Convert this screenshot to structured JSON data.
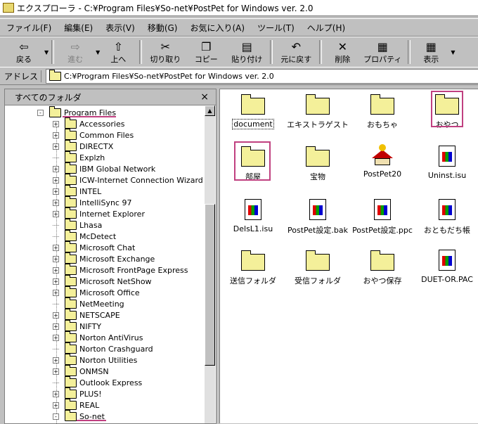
{
  "window": {
    "title": "エクスプローラ - C:¥Program Files¥So-net¥PostPet for Windows ver. 2.0"
  },
  "menu": [
    "ファイル(F)",
    "編集(E)",
    "表示(V)",
    "移動(G)",
    "お気に入り(A)",
    "ツール(T)",
    "ヘルプ(H)"
  ],
  "toolbar": {
    "back": "戻る",
    "forward": "進む",
    "up": "上へ",
    "cut": "切り取り",
    "copy": "コピー",
    "paste": "貼り付け",
    "undo": "元に戻す",
    "delete": "削除",
    "properties": "プロパティ",
    "view": "表示"
  },
  "address": {
    "label": "アドレス",
    "value": "C:¥Program Files¥So-net¥PostPet for Windows ver. 2.0"
  },
  "folders_pane": {
    "title": "すべてのフォルダ",
    "close": "×"
  },
  "tree": [
    {
      "label": "Program Files",
      "expand": "-"
    },
    {
      "label": "Accessories",
      "expand": "+"
    },
    {
      "label": "Common Files",
      "expand": "+"
    },
    {
      "label": "DIRECTX",
      "expand": "+"
    },
    {
      "label": "Explzh",
      "expand": ""
    },
    {
      "label": "IBM Global Network",
      "expand": "+"
    },
    {
      "label": "ICW-Internet Connection Wizard",
      "expand": "+"
    },
    {
      "label": "INTEL",
      "expand": "+"
    },
    {
      "label": "IntelliSync 97",
      "expand": "+"
    },
    {
      "label": "Internet Explorer",
      "expand": "+"
    },
    {
      "label": "Lhasa",
      "expand": ""
    },
    {
      "label": "McDetect",
      "expand": ""
    },
    {
      "label": "Microsoft Chat",
      "expand": "+"
    },
    {
      "label": "Microsoft Exchange",
      "expand": "+"
    },
    {
      "label": "Microsoft FrontPage Express",
      "expand": "+"
    },
    {
      "label": "Microsoft NetShow",
      "expand": "+"
    },
    {
      "label": "Microsoft Office",
      "expand": "+"
    },
    {
      "label": "NetMeeting",
      "expand": ""
    },
    {
      "label": "NETSCAPE",
      "expand": "+"
    },
    {
      "label": "NIFTY",
      "expand": "+"
    },
    {
      "label": "Norton AntiVirus",
      "expand": "+"
    },
    {
      "label": "Norton Crashguard",
      "expand": ""
    },
    {
      "label": "Norton Utilities",
      "expand": "+"
    },
    {
      "label": "ONMSN",
      "expand": "+"
    },
    {
      "label": "Outlook Express",
      "expand": ""
    },
    {
      "label": "PLUS!",
      "expand": "+"
    },
    {
      "label": "REAL",
      "expand": "+"
    },
    {
      "label": "So-net",
      "expand": "-"
    }
  ],
  "files": [
    {
      "label": "document",
      "kind": "folder"
    },
    {
      "label": "エキストラゲスト",
      "kind": "folder"
    },
    {
      "label": "おもちゃ",
      "kind": "folder"
    },
    {
      "label": "おやつ",
      "kind": "folder"
    },
    {
      "label": "部屋",
      "kind": "folder"
    },
    {
      "label": "宝物",
      "kind": "folder"
    },
    {
      "label": "PostPet20",
      "kind": "app"
    },
    {
      "label": "Uninst.isu",
      "kind": "doc"
    },
    {
      "label": "DelsL1.isu",
      "kind": "doc"
    },
    {
      "label": "PostPet設定.bak",
      "kind": "doc"
    },
    {
      "label": "PostPet設定.ppc",
      "kind": "doc"
    },
    {
      "label": "おともだち帳",
      "kind": "doc"
    },
    {
      "label": "送信フォルダ",
      "kind": "folder"
    },
    {
      "label": "受信フォルダ",
      "kind": "folder"
    },
    {
      "label": "おやつ保存",
      "kind": "folder"
    },
    {
      "label": "DUET-OR.PAC",
      "kind": "doc"
    }
  ],
  "colors": {
    "highlight": "#c04080",
    "folder": "#f4f09a"
  }
}
